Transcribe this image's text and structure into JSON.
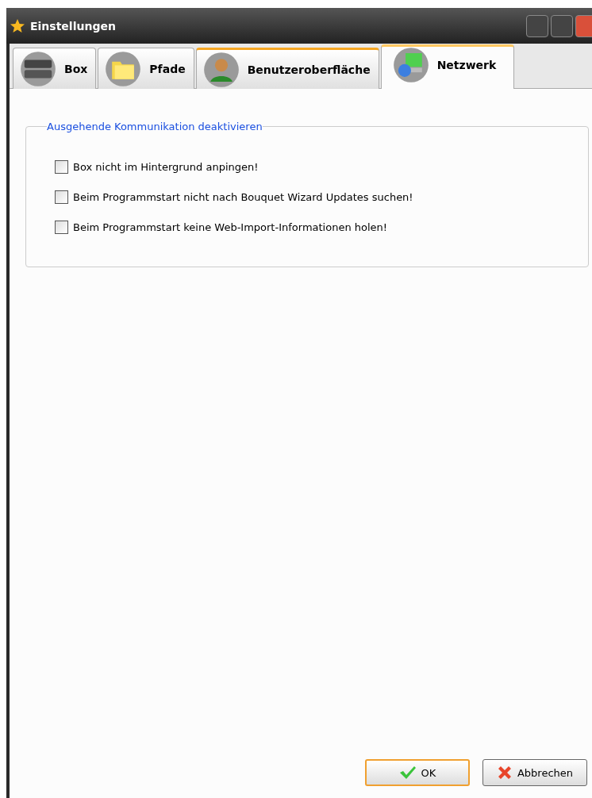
{
  "window": {
    "title": "Einstellungen"
  },
  "tabs": [
    {
      "label": "Box",
      "kind": "box",
      "selected": false,
      "hovered": false
    },
    {
      "label": "Pfade",
      "kind": "folder",
      "selected": false,
      "hovered": false
    },
    {
      "label": "Benutzeroberfläche",
      "kind": "user",
      "selected": false,
      "hovered": true
    },
    {
      "label": "Netzwerk",
      "kind": "network",
      "selected": true,
      "hovered": false
    }
  ],
  "group": {
    "title": "Ausgehende Kommunikation deaktivieren",
    "options": [
      {
        "label": "Box nicht im Hintergrund anpingen!",
        "checked": false
      },
      {
        "label": "Beim Programmstart nicht nach Bouquet Wizard Updates suchen!",
        "checked": false
      },
      {
        "label": "Beim Programmstart keine Web-Import-Informationen holen!",
        "checked": false
      }
    ]
  },
  "buttons": [
    {
      "label": "OK",
      "kind": "ok",
      "default": true
    },
    {
      "label": "Abbrechen",
      "kind": "cancel",
      "default": false
    }
  ]
}
